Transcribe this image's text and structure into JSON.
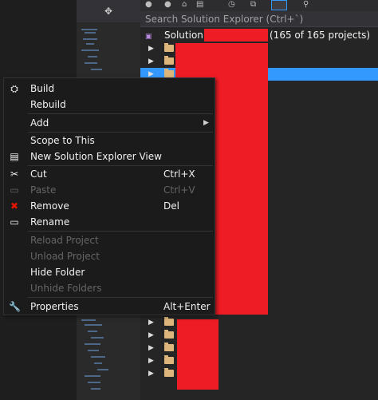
{
  "search": {
    "placeholder": "Search Solution Explorer (Ctrl+`)"
  },
  "solution": {
    "label_prefix": "Solution '",
    "label_suffix": "'",
    "count": "(165 of 165 projects)"
  },
  "colors": {
    "accent": "#3399ff",
    "redaction": "#ee1c25",
    "folder": "#dcb67a"
  },
  "context_menu": {
    "items": [
      {
        "label": "Build",
        "shortcut": "",
        "icon": "build-icon",
        "disabled": false
      },
      {
        "label": "Rebuild",
        "shortcut": "",
        "icon": "",
        "disabled": false
      },
      {
        "label": "Add",
        "shortcut": "",
        "icon": "",
        "disabled": false,
        "submenu": true
      },
      {
        "label": "Scope to This",
        "shortcut": "",
        "icon": "",
        "disabled": false
      },
      {
        "label": "New Solution Explorer View",
        "shortcut": "",
        "icon": "new-view-icon",
        "disabled": false
      },
      {
        "label": "Cut",
        "shortcut": "Ctrl+X",
        "icon": "scissors-icon",
        "disabled": false
      },
      {
        "label": "Paste",
        "shortcut": "Ctrl+V",
        "icon": "paste-icon",
        "disabled": true
      },
      {
        "label": "Remove",
        "shortcut": "Del",
        "icon": "remove-icon",
        "disabled": false
      },
      {
        "label": "Rename",
        "shortcut": "",
        "icon": "rename-icon",
        "disabled": false
      },
      {
        "label": "Reload Project",
        "shortcut": "",
        "icon": "",
        "disabled": true
      },
      {
        "label": "Unload Project",
        "shortcut": "",
        "icon": "",
        "disabled": true
      },
      {
        "label": "Hide Folder",
        "shortcut": "",
        "icon": "",
        "disabled": false
      },
      {
        "label": "Unhide Folders",
        "shortcut": "",
        "icon": "",
        "disabled": true
      },
      {
        "label": "Properties",
        "shortcut": "Alt+Enter",
        "icon": "wrench-icon",
        "disabled": false
      }
    ]
  }
}
